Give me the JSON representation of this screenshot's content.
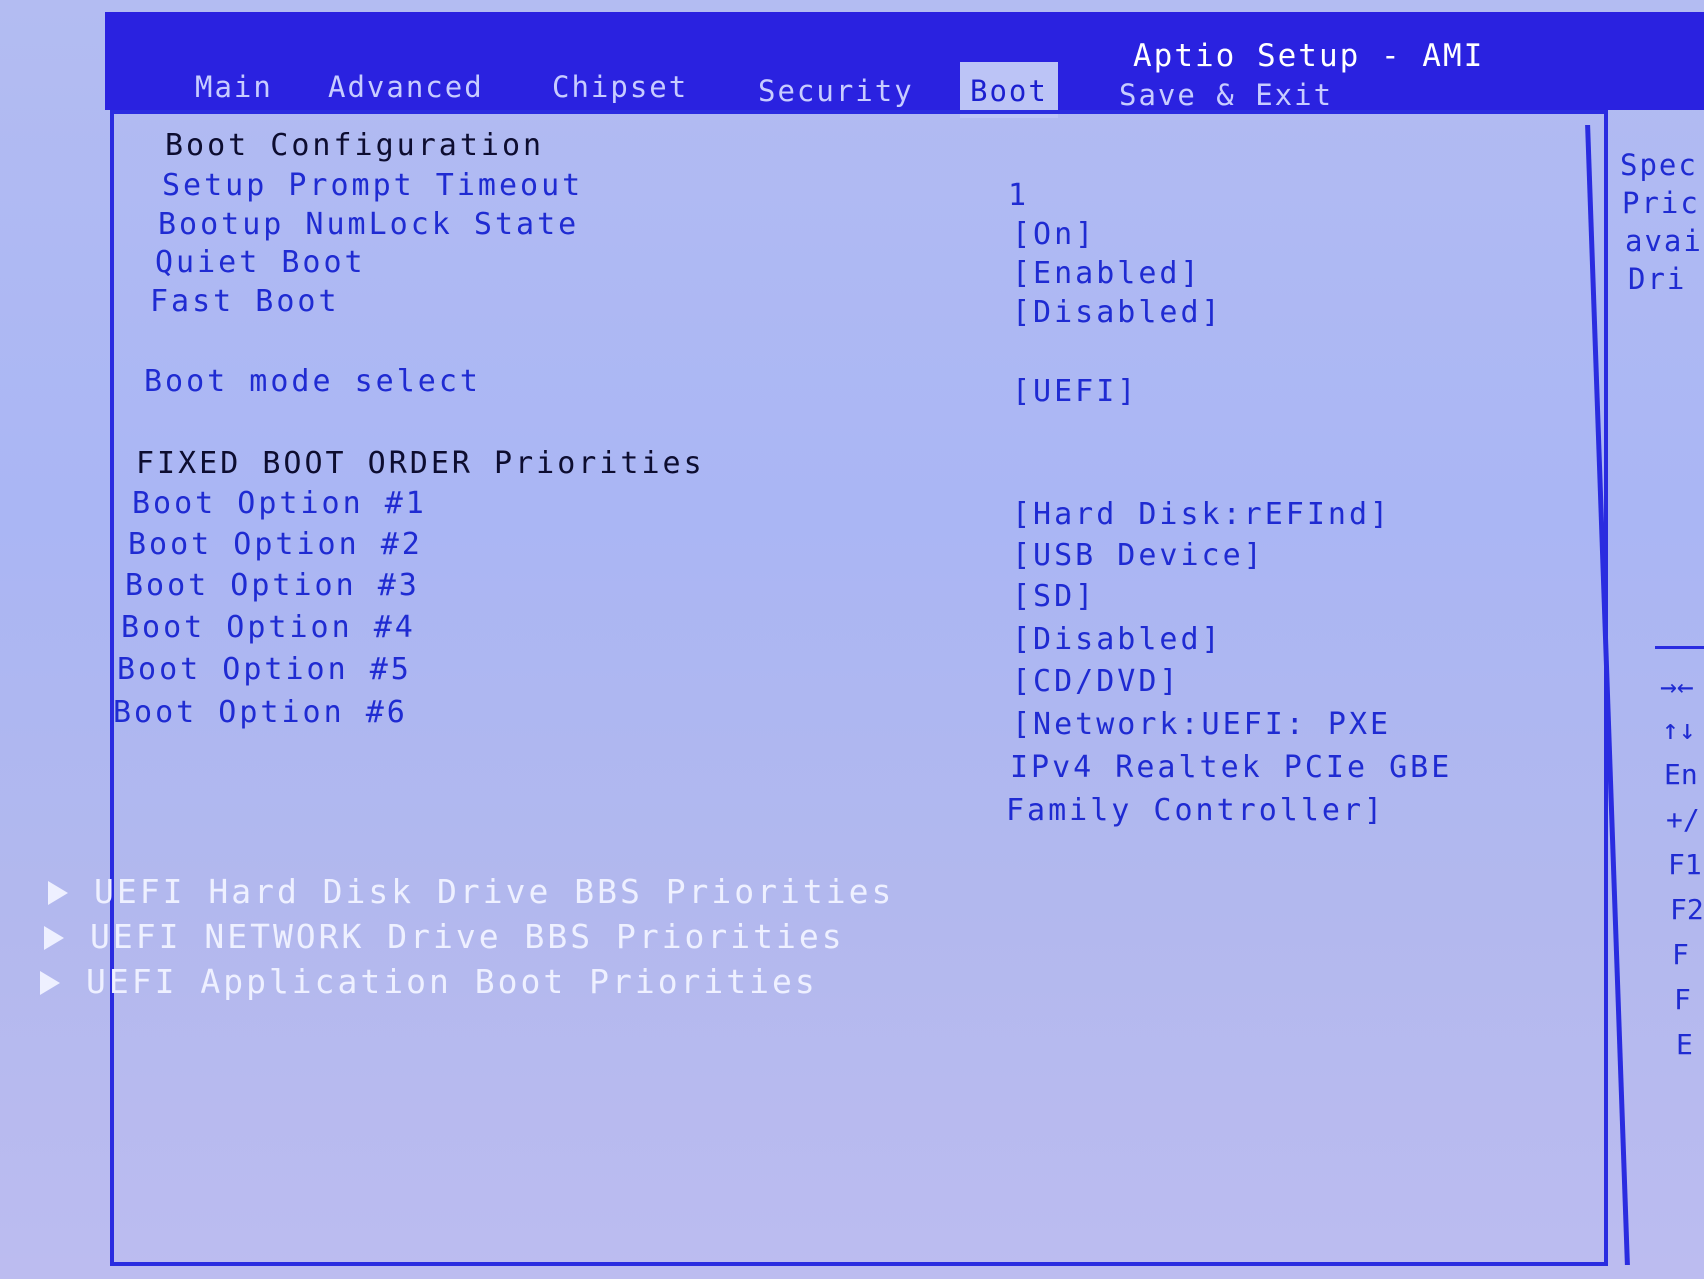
{
  "header": {
    "title": "Aptio Setup - AMI",
    "tabs": [
      {
        "label": "Main"
      },
      {
        "label": "Advanced"
      },
      {
        "label": "Chipset"
      },
      {
        "label": "Security"
      },
      {
        "label": "Boot",
        "active": true
      },
      {
        "label": "Save & Exit"
      }
    ]
  },
  "boot": {
    "section_config": "Boot Configuration",
    "settings": [
      {
        "label": "Setup Prompt Timeout",
        "value": "1"
      },
      {
        "label": "Bootup NumLock State",
        "value": "[On]"
      },
      {
        "label": "Quiet Boot",
        "value": "[Enabled]"
      },
      {
        "label": "Fast Boot",
        "value": "[Disabled]"
      },
      {
        "label": "Boot mode select",
        "value": "[UEFI]"
      }
    ],
    "section_order": "FIXED BOOT ORDER Priorities",
    "options": [
      {
        "label": "Boot Option #1",
        "value": "[Hard Disk:rEFInd]"
      },
      {
        "label": "Boot Option #2",
        "value": "[USB Device]"
      },
      {
        "label": "Boot Option #3",
        "value": "[SD]"
      },
      {
        "label": "Boot Option #4",
        "value": "[Disabled]"
      },
      {
        "label": "Boot Option #5",
        "value": "[CD/DVD]"
      },
      {
        "label": "Boot Option #6",
        "value": "[Network:UEFI: PXE",
        "value_line2": "IPv4 Realtek PCIe GBE",
        "value_line3": "Family Controller]"
      }
    ],
    "submenus": [
      {
        "label": "UEFI Hard Disk Drive BBS Priorities"
      },
      {
        "label": "UEFI NETWORK Drive BBS Priorities"
      },
      {
        "label": "UEFI Application Boot Priorities"
      }
    ]
  },
  "help": {
    "lines": [
      "Spec",
      "Pric",
      "avai",
      "Dri"
    ],
    "keys": [
      "→←",
      "↑↓",
      "En",
      "+/",
      "F1",
      "F2",
      "F",
      "F",
      "E"
    ]
  },
  "colors": {
    "header": "#2a22e0",
    "background": "#aab6f4",
    "item_text": "#1f2bd2",
    "submenu_text": "#eef0ff"
  }
}
